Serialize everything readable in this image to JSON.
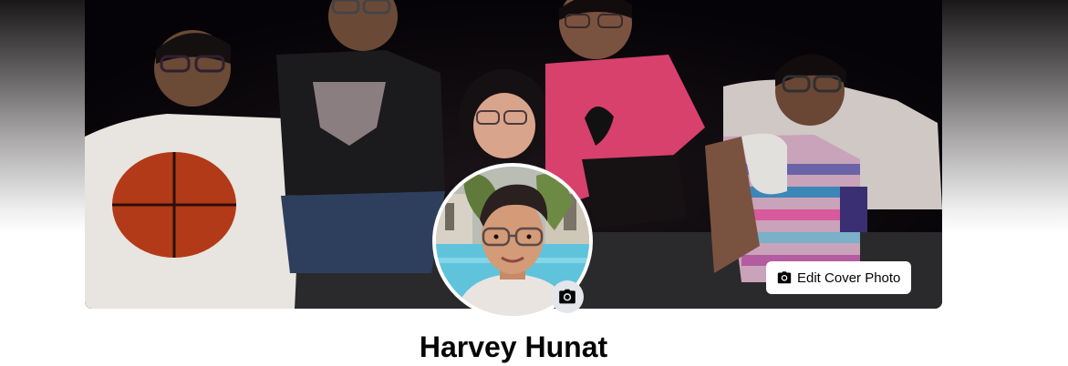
{
  "cover": {
    "edit_button_label": "Edit Cover Photo",
    "edit_button_icon": "camera-icon"
  },
  "avatar": {
    "camera_icon": "camera-icon"
  },
  "profile": {
    "name": "Harvey Hunat"
  },
  "colors": {
    "button_bg": "#ffffff",
    "camera_button_bg": "#e4e6eb",
    "text_primary": "#050505"
  }
}
